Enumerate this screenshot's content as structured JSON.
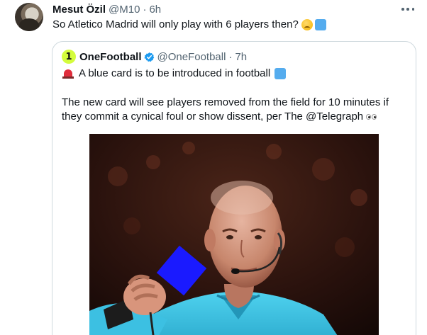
{
  "tweet": {
    "display_name": "Mesut Özil",
    "handle": "@M10",
    "separator": "·",
    "time": "6h",
    "text": "So Atletico Madrid will only play with 6 players then?",
    "emojis": [
      "thinking-face",
      "blue-square"
    ]
  },
  "quoted_tweet": {
    "avatar_glyph": "1",
    "display_name": "OneFootball",
    "verified": true,
    "handle": "@OneFootball",
    "separator": "·",
    "time": "7h",
    "line1": "A blue card is to be introduced in football",
    "line1_emojis": [
      "rotating-light",
      "blue-square"
    ],
    "body_line1": "The new card will see players removed from the field for 10 minutes if",
    "body_line2": "they commit a cynical foul or show dissent, per The @Telegraph",
    "body_emoji": "eyes",
    "media_icon": "referee-holding-blue-card-photo"
  },
  "colors": {
    "text": "#0f1419",
    "secondary": "#536471",
    "border": "#cfd9de",
    "verified": "#1d9bf0",
    "blue_card": "#1a1aff",
    "brand_lime": "#d4fc3c"
  }
}
